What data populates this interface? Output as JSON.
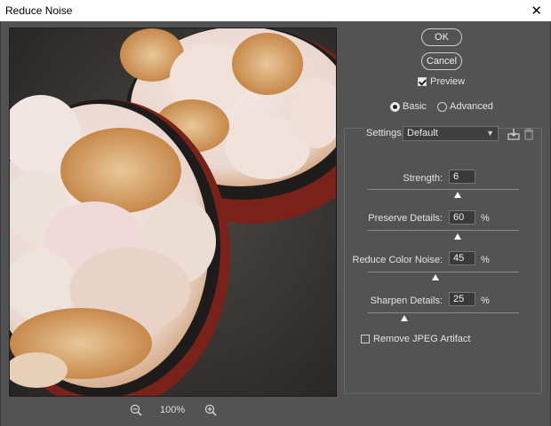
{
  "window": {
    "title": "Reduce Noise",
    "close_glyph": "✕"
  },
  "buttons": {
    "ok": "OK",
    "cancel": "Cancel"
  },
  "preview_checkbox": {
    "label": "Preview",
    "checked": true
  },
  "mode": {
    "basic": "Basic",
    "advanced": "Advanced",
    "selected": "Basic"
  },
  "settings": {
    "label": "Settings:",
    "value": "Default",
    "save_icon": "save-icon",
    "delete_icon": "trash-icon"
  },
  "sliders": {
    "strength": {
      "label": "Strength:",
      "value": "6",
      "unit": ""
    },
    "preserve_details": {
      "label": "Preserve Details:",
      "value": "60",
      "unit": "%"
    },
    "reduce_color_noise": {
      "label": "Reduce Color Noise:",
      "value": "45",
      "unit": "%"
    },
    "sharpen_details": {
      "label": "Sharpen Details:",
      "value": "25",
      "unit": "%"
    }
  },
  "jpeg_artifact": {
    "label": "Remove JPEG Artifact",
    "checked": false
  },
  "zoom": {
    "level": "100%"
  }
}
